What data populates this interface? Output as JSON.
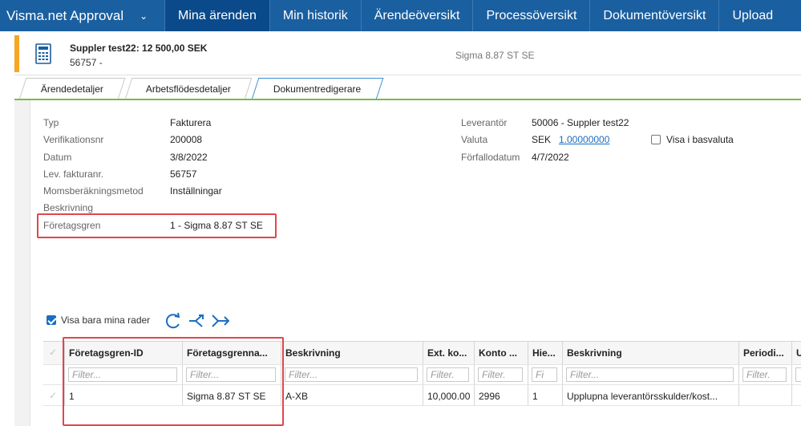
{
  "nav": {
    "brand": "Visma.net Approval",
    "items": [
      {
        "label": "Mina ärenden",
        "active": true
      },
      {
        "label": "Min historik"
      },
      {
        "label": "Ärendeöversikt"
      },
      {
        "label": "Processöversikt"
      },
      {
        "label": "Dokumentöversikt"
      },
      {
        "label": "Upload"
      }
    ]
  },
  "header": {
    "title": "Suppler test22: 12 500,00 SEK",
    "subtitle": "56757 -",
    "center": "Sigma 8.87 ST SE"
  },
  "tabs": [
    "Ärendedetaljer",
    "Arbetsflödesdetaljer",
    "Dokumentredigerare"
  ],
  "details": {
    "left": [
      {
        "label": "Typ",
        "value": "Fakturera"
      },
      {
        "label": "Verifikationsnr",
        "value": "200008"
      },
      {
        "label": "Datum",
        "value": "3/8/2022"
      },
      {
        "label": "Lev. fakturanr.",
        "value": "56757"
      },
      {
        "label": "Momsberäkningsmetod",
        "value": "Inställningar"
      },
      {
        "label": "Beskrivning",
        "value": ""
      },
      {
        "label": "Företagsgren",
        "value": "1 - Sigma 8.87 ST SE"
      }
    ],
    "right": {
      "supplier_label": "Leverantör",
      "supplier_value": "50006 - Suppler test22",
      "currency_label": "Valuta",
      "currency_code": "SEK",
      "currency_rate": "1.00000000",
      "base_currency_label": "Visa i basvaluta",
      "due_label": "Förfallodatum",
      "due_value": "4/7/2022"
    }
  },
  "toolbar": {
    "show_mine_label": "Visa bara mina rader"
  },
  "grid": {
    "columns": [
      {
        "header": "Företagsgren-ID",
        "filter": "Filter..."
      },
      {
        "header": "Företagsgrenna...",
        "filter": "Filter..."
      },
      {
        "header": "Beskrivning",
        "filter": "Filter..."
      },
      {
        "header": "Ext. ko...",
        "filter": "Filter."
      },
      {
        "header": "Konto ...",
        "filter": "Filter."
      },
      {
        "header": "Hie...",
        "filter": "Fi"
      },
      {
        "header": "Beskrivning",
        "filter": "Filter..."
      },
      {
        "header": "Periodi...",
        "filter": "Filter."
      },
      {
        "header": "U",
        "filter": ""
      }
    ],
    "rows": [
      [
        "1",
        "Sigma 8.87 ST SE",
        "A-XB",
        "10,000.00",
        "2996",
        "1",
        "Upplupna leverantörsskulder/kost...",
        "",
        ""
      ]
    ]
  },
  "colors": {
    "nav_bg": "#1a5fa0",
    "nav_active": "#0a4a8a",
    "accent_orange": "#f5a623",
    "tab_underline": "#7bba4a",
    "highlight_red": "#e0474c",
    "link_blue": "#1a6fc2"
  }
}
